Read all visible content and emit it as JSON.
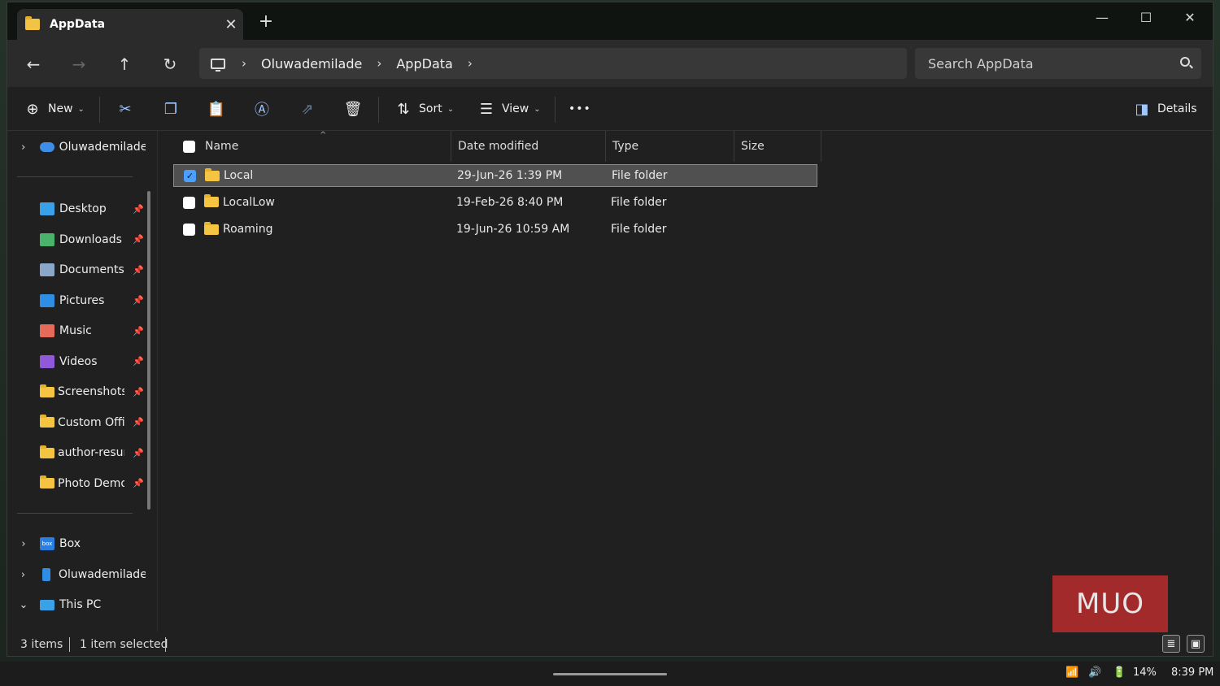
{
  "window": {
    "tab_title": "AppData",
    "tab_close": "✕",
    "new_tab": "+",
    "minimize": "—",
    "maximize": "☐",
    "close": "✕"
  },
  "nav": {
    "back": "←",
    "forward": "→",
    "up": "↑",
    "refresh": "↻"
  },
  "address": {
    "breadcrumbs": [
      "Oluwademilade",
      "AppData"
    ],
    "separator": "›",
    "search_placeholder": "Search AppData"
  },
  "toolbar": {
    "new_label": "New",
    "sort_label": "Sort",
    "view_label": "View",
    "more_label": "•••",
    "details_label": "Details",
    "caret": "⌄"
  },
  "sidebar": {
    "root": "Oluwademilade",
    "quick_access": [
      {
        "label": "Desktop",
        "icon": "desktop-icon",
        "color": "#3aa0e8"
      },
      {
        "label": "Downloads",
        "icon": "download-icon",
        "color": "#49b36b"
      },
      {
        "label": "Documents",
        "icon": "document-icon",
        "color": "#8aa7c9"
      },
      {
        "label": "Pictures",
        "icon": "pictures-icon",
        "color": "#2f8de4"
      },
      {
        "label": "Music",
        "icon": "music-icon",
        "color": "#e56a5a"
      },
      {
        "label": "Videos",
        "icon": "videos-icon",
        "color": "#8f59d9"
      },
      {
        "label": "Screenshots",
        "icon": "folder-icon",
        "color": "#f5c542"
      },
      {
        "label": "Custom Offic",
        "icon": "folder-icon",
        "color": "#f5c542"
      },
      {
        "label": "author-resum",
        "icon": "folder-icon",
        "color": "#f5c542"
      },
      {
        "label": "Photo Demo",
        "icon": "folder-icon",
        "color": "#f5c542"
      }
    ],
    "pin": "📌",
    "locations": [
      {
        "label": "Box",
        "icon": "box-icon",
        "color": "#2a7de1",
        "chevron": "›"
      },
      {
        "label": "Oluwademilade'",
        "icon": "phone-icon",
        "color": "#2f8de4",
        "chevron": "›"
      },
      {
        "label": "This PC",
        "icon": "this-pc-icon",
        "color": "#3aa0e8",
        "chevron": "⌄"
      }
    ],
    "box_badge": "box"
  },
  "columns": {
    "name": "Name",
    "date": "Date modified",
    "type": "Type",
    "size": "Size"
  },
  "files": [
    {
      "name": "Local",
      "date": "29-Jun-26 1:39 PM",
      "type": "File folder",
      "selected": true
    },
    {
      "name": "LocalLow",
      "date": "19-Feb-26 8:40 PM",
      "type": "File folder",
      "selected": false
    },
    {
      "name": "Roaming",
      "date": "19-Jun-26 10:59 AM",
      "type": "File folder",
      "selected": false
    }
  ],
  "status": {
    "items": "3 items",
    "selected": "1 item selected"
  },
  "watermark": "MUO",
  "taskbar": {
    "battery": "14%",
    "time": "8:39 PM"
  }
}
